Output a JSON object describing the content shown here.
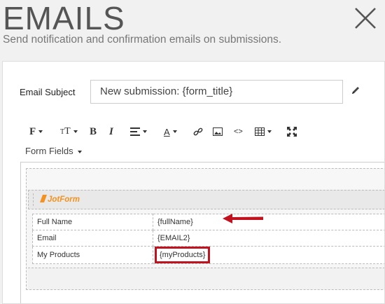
{
  "header": {
    "title": "EMAILS",
    "subtitle": "Send notification and confirmation emails on submissions."
  },
  "email": {
    "subject_label": "Email Subject",
    "subject_value": "New submission: {form_title}"
  },
  "toolbar": {
    "form_fields_label": "Form Fields"
  },
  "editor": {
    "logo_text": "JotForm",
    "rows": [
      {
        "label": "Full Name",
        "value": "{fullName}"
      },
      {
        "label": "Email",
        "value": "{EMAIL2}"
      },
      {
        "label": "My Products",
        "value": "{myProducts}"
      }
    ]
  },
  "colors": {
    "highlight": "#c1121f",
    "logo": "#f39221"
  }
}
